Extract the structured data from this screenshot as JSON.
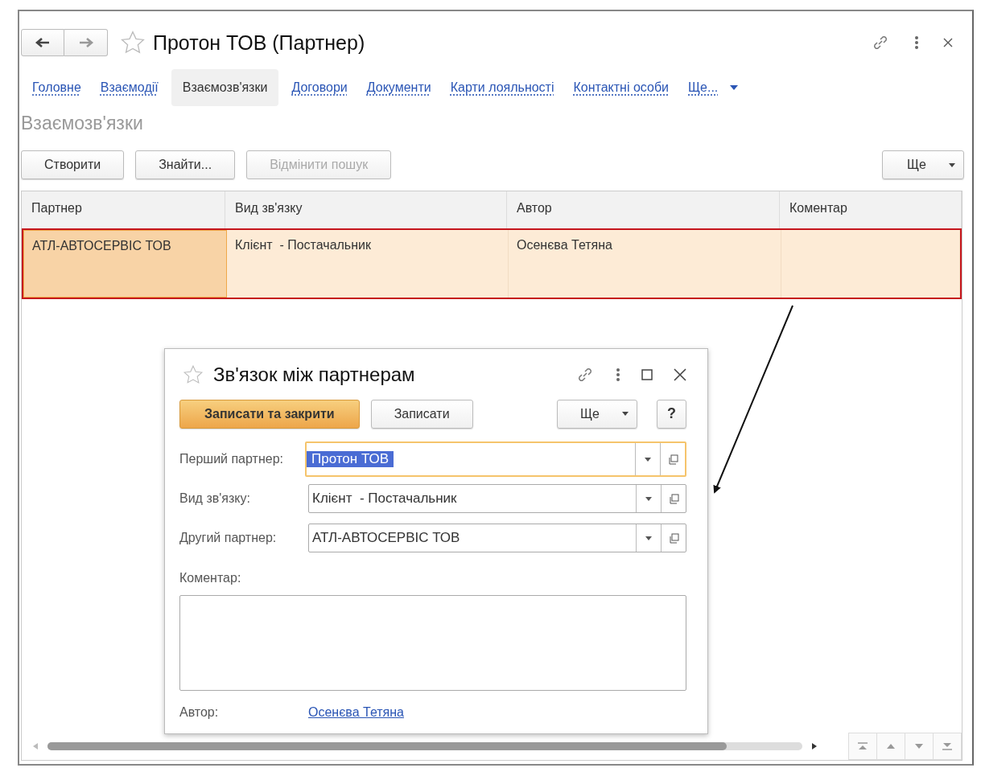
{
  "window": {
    "title": "Протон ТОВ (Партнер)"
  },
  "tabs": [
    {
      "label": "Головне",
      "selected": false,
      "kind": "link"
    },
    {
      "label": "Взаємодії",
      "selected": false,
      "kind": "link"
    },
    {
      "label": "Взаємозв'язки",
      "selected": true,
      "kind": "link"
    },
    {
      "label": "Договори",
      "selected": false,
      "kind": "link"
    },
    {
      "label": "Документи",
      "selected": false,
      "kind": "link"
    },
    {
      "label": "Карти лояльності",
      "selected": false,
      "kind": "link"
    },
    {
      "label": "Контактні особи",
      "selected": false,
      "kind": "link"
    },
    {
      "label": "Ще...",
      "selected": false,
      "kind": "more"
    }
  ],
  "section_title": "Взаємозв'язки",
  "toolbar": {
    "buttons": [
      {
        "label": "Створити",
        "disabled": false
      },
      {
        "label": "Знайти...",
        "disabled": false
      },
      {
        "label": "Відмінити пошук",
        "disabled": true
      }
    ],
    "more": "Ще"
  },
  "table": {
    "columns": [
      "Партнер",
      "Вид зв'язку",
      "Автор",
      "Коментар"
    ],
    "rows": [
      {
        "cells": [
          "АТЛ-АВТОСЕРВІС ТОВ",
          "Клієнт  - Постачальник",
          "Осенєва Тетяна",
          ""
        ],
        "selected": true
      }
    ]
  },
  "dialog": {
    "title": "Зв'язок між партнерам",
    "buttons": [
      {
        "label": "Записати та закрити",
        "kind": "primary"
      },
      {
        "label": "Записати",
        "kind": "default"
      }
    ],
    "more": "Ще",
    "help": "?",
    "fields": [
      {
        "label": "Перший партнер:",
        "value": "Протон ТОВ",
        "focused": true
      },
      {
        "label": "Вид зв'язку:",
        "value": "Клієнт  - Постачальник",
        "focused": false
      },
      {
        "label": "Другий партнер:",
        "value": "АТЛ-АВТОСЕРВІС ТОВ",
        "focused": false
      }
    ],
    "comment_label": "Коментар:",
    "author_label": "Автор:",
    "author": "Осенєва Тетяна"
  }
}
